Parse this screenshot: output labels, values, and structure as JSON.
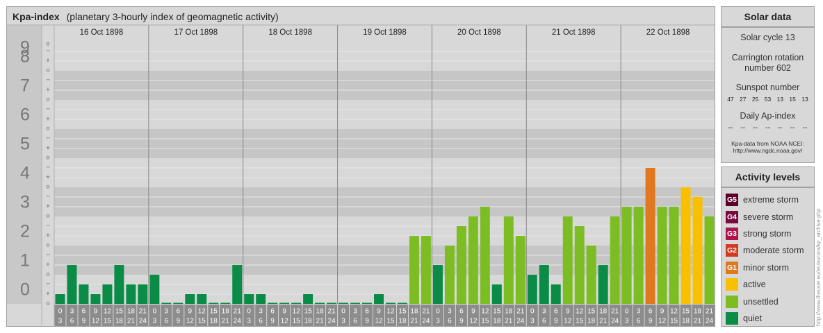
{
  "header": {
    "title_bold": "Kpa-index",
    "title_rest": "(planetary 3-hourly index of geomagnetic activity)"
  },
  "solar": {
    "title": "Solar data",
    "cycle": "Solar cycle 13",
    "carrington_1": "Carrington rotation",
    "carrington_2": "number 602",
    "sunspot_label": "Sunspot number",
    "sunspots": [
      "47",
      "27",
      "25",
      "53",
      "13",
      "15",
      "13"
    ],
    "ap_label": "Daily Ap-index",
    "ap": [
      "--",
      "--",
      "--",
      "--",
      "--",
      "--",
      "--"
    ],
    "source_1": "Kpa-data from NOAA NCEI:",
    "source_2": "http://www.ngdc.noaa.gov/"
  },
  "levels": {
    "title": "Activity levels",
    "items": [
      {
        "badge": "G5",
        "label": "extreme storm",
        "color": "#5c0029"
      },
      {
        "badge": "G4",
        "label": "severe storm",
        "color": "#7a0a3c"
      },
      {
        "badge": "G3",
        "label": "strong storm",
        "color": "#b0124e"
      },
      {
        "badge": "G2",
        "label": "moderate storm",
        "color": "#d23b1f"
      },
      {
        "badge": "G1",
        "label": "minor storm",
        "color": "#e07820"
      },
      {
        "badge": "",
        "label": "active",
        "color": "#f8c000"
      },
      {
        "badge": "",
        "label": "unsettled",
        "color": "#7dbd24"
      },
      {
        "badge": "",
        "label": "quiet",
        "color": "#0a8c46"
      }
    ]
  },
  "credit": "http://www.theuser.eu/en/aurora/kp_archive.php",
  "chart_data": {
    "type": "bar",
    "title": "Kpa-index",
    "subtitle": "(planetary 3-hourly index of geomagnetic activity)",
    "ylim": [
      0,
      9
    ],
    "yticks": [
      "0",
      "1",
      "2",
      "3",
      "4",
      "5",
      "6",
      "7",
      "8",
      "9"
    ],
    "ysub": [
      "o",
      "+",
      "−"
    ],
    "days": [
      "16 Oct 1898",
      "17 Oct 1898",
      "18 Oct 1898",
      "19 Oct 1898",
      "20 Oct 1898",
      "21 Oct 1898",
      "22 Oct 1898"
    ],
    "slot_top": [
      "0",
      "3",
      "6",
      "9",
      "12",
      "15",
      "18",
      "21"
    ],
    "slot_bottom": [
      "3",
      "6",
      "9",
      "12",
      "15",
      "18",
      "21",
      "24"
    ],
    "values": [
      [
        0.333,
        1.333,
        0.667,
        0.333,
        0.667,
        1.333,
        0.667,
        0.667
      ],
      [
        1.0,
        0,
        0,
        0.333,
        0.333,
        0,
        0,
        1.333
      ],
      [
        0.333,
        0.333,
        0,
        0,
        0,
        0.333,
        0,
        0
      ],
      [
        0,
        0,
        0,
        0.333,
        0,
        0,
        2.333,
        2.333
      ],
      [
        1.333,
        2.0,
        2.667,
        3.0,
        3.333,
        0.667,
        3.0,
        2.333
      ],
      [
        1.0,
        1.333,
        0.667,
        3.0,
        2.667,
        2.0,
        1.333,
        3.0
      ],
      [
        3.333,
        3.333,
        4.667,
        3.333,
        3.333,
        4.0,
        3.667,
        3.0
      ]
    ],
    "colors": {
      "quiet": "#0a8c46",
      "unsettled": "#7dbd24",
      "active": "#f8c000",
      "minor": "#e07820"
    }
  }
}
